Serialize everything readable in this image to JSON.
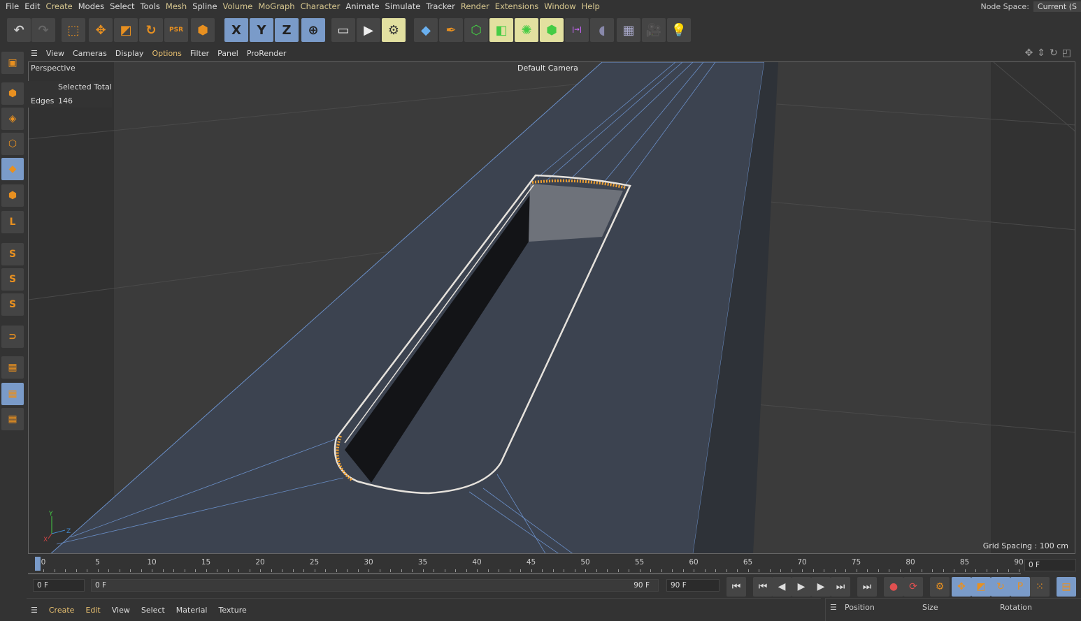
{
  "menu": [
    "File",
    "Edit",
    "Create",
    "Modes",
    "Select",
    "Tools",
    "Mesh",
    "Spline",
    "Volume",
    "MoGraph",
    "Character",
    "Animate",
    "Simulate",
    "Tracker",
    "Render",
    "Extensions",
    "Window",
    "Help"
  ],
  "node_space": {
    "label": "Node Space:",
    "value": "Current (S"
  },
  "toolbar": [
    {
      "name": "undo-icon",
      "glyph": "↶"
    },
    {
      "name": "redo-icon",
      "glyph": "↷"
    },
    {
      "name": "live-selection-icon",
      "glyph": "⬚"
    },
    {
      "name": "move-icon",
      "glyph": "✥"
    },
    {
      "name": "scale-icon",
      "glyph": "◩"
    },
    {
      "name": "rotate-icon",
      "glyph": "↻"
    },
    {
      "name": "psr-icon",
      "glyph": "PSR"
    },
    {
      "name": "object-mode-icon",
      "glyph": "⬢"
    },
    {
      "name": "x-axis-icon",
      "glyph": "X"
    },
    {
      "name": "y-axis-icon",
      "glyph": "Y"
    },
    {
      "name": "z-axis-icon",
      "glyph": "Z"
    },
    {
      "name": "world-coord-icon",
      "glyph": "⊕"
    },
    {
      "name": "render-view-icon",
      "glyph": "▭"
    },
    {
      "name": "render-picture-viewer-icon",
      "glyph": "▶"
    },
    {
      "name": "render-settings-icon",
      "glyph": "⚙"
    },
    {
      "name": "cube-icon",
      "glyph": "◆"
    },
    {
      "name": "pen-icon",
      "glyph": "✒"
    },
    {
      "name": "subdivision-icon",
      "glyph": "⬡"
    },
    {
      "name": "extrude-icon",
      "glyph": "◧"
    },
    {
      "name": "cloner-icon",
      "glyph": "✺"
    },
    {
      "name": "mograph-icon",
      "glyph": "⬢"
    },
    {
      "name": "deformer-icon",
      "glyph": "|→|"
    },
    {
      "name": "field-icon",
      "glyph": "◖"
    },
    {
      "name": "floor-icon",
      "glyph": "▦"
    },
    {
      "name": "camera-icon",
      "glyph": "🎥"
    },
    {
      "name": "light-icon",
      "glyph": "💡"
    }
  ],
  "left_toolbar": [
    "make-editable-icon",
    "model-mode-icon",
    "texture-mode-icon",
    "points-mode-icon",
    "edges-mode-icon",
    "polygons-mode-icon",
    "axis-mode-icon",
    "solo-icon",
    "solo-hierarchy-icon",
    "solo-off-icon",
    "snap-icon",
    "workplane-icon",
    "locked-workplane-icon",
    "workplane-snap-icon"
  ],
  "viewport_menu": [
    "View",
    "Cameras",
    "Display",
    "Options",
    "Filter",
    "Panel",
    "ProRender"
  ],
  "viewport": {
    "view_name": "Perspective",
    "camera": "Default Camera",
    "stats_header": "Selected Total",
    "stats_label": "Edges",
    "stats_value": "146",
    "grid_spacing": "Grid Spacing : 100 cm",
    "axis": {
      "x": "X",
      "y": "Y",
      "z": "Z"
    }
  },
  "colors": {
    "accent": "#7a9bc9",
    "selection": "#f0a030",
    "wire": "#6a8fc8"
  },
  "timeline": {
    "ticks": [
      "0",
      "5",
      "10",
      "15",
      "20",
      "25",
      "30",
      "35",
      "40",
      "45",
      "50",
      "55",
      "60",
      "65",
      "70",
      "75",
      "80",
      "85",
      "90"
    ],
    "current_frame": "0 F",
    "start": "0 F",
    "range_start": "0 F",
    "range_end": "90 F",
    "end": "90 F"
  },
  "playback": [
    "go-to-start-icon",
    "prev-key-icon",
    "prev-frame-icon",
    "play-icon",
    "next-frame-icon",
    "next-key-icon",
    "go-to-end-icon",
    "record-icon",
    "autokey-icon",
    "keyframe-settings-icon",
    "key-position-icon",
    "key-scale-icon",
    "key-rotation-icon",
    "key-param-icon",
    "key-pla-icon",
    "timeline-icon"
  ],
  "material_menu": [
    "Create",
    "Edit",
    "View",
    "Select",
    "Material",
    "Texture"
  ],
  "coords": {
    "position": "Position",
    "size": "Size",
    "rotation": "Rotation"
  }
}
